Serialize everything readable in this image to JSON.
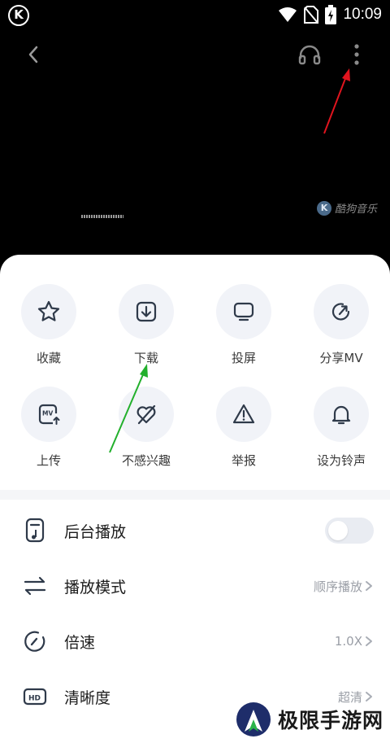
{
  "status_bar": {
    "app_logo": "K",
    "time": "10:09",
    "icons": [
      "wifi-icon",
      "no-sim-icon",
      "battery-icon"
    ]
  },
  "video_header": {
    "icons": [
      "back-icon",
      "headphones-icon",
      "more-vertical-icon"
    ],
    "watermark_text": "酷狗音乐",
    "watermark_logo": "K"
  },
  "sheet": {
    "grid_row1": [
      {
        "label": "收藏",
        "icon": "star-icon"
      },
      {
        "label": "下载",
        "icon": "download-icon"
      },
      {
        "label": "投屏",
        "icon": "cast-screen-icon"
      },
      {
        "label": "分享MV",
        "icon": "share-icon"
      }
    ],
    "grid_row2": [
      {
        "label": "上传",
        "icon": "upload-mv-icon"
      },
      {
        "label": "不感兴趣",
        "icon": "not-interested-icon"
      },
      {
        "label": "举报",
        "icon": "report-icon"
      },
      {
        "label": "设为铃声",
        "icon": "bell-icon"
      }
    ],
    "settings": [
      {
        "label": "后台播放",
        "icon": "background-play-icon",
        "control": "toggle",
        "toggle_on": false
      },
      {
        "label": "播放模式",
        "icon": "play-mode-icon",
        "value": "顺序播放"
      },
      {
        "label": "倍速",
        "icon": "speed-icon",
        "value": "1.0X"
      },
      {
        "label": "清晰度",
        "icon": "hd-icon",
        "value": "超清"
      }
    ]
  },
  "site_watermark": "极限手游网",
  "colors": {
    "sheet_bg": "#ffffff",
    "icon_circle_bg": "#f1f3f8",
    "icon_stroke": "#2f3a4a",
    "annotation_red": "#e0141e",
    "annotation_green": "#22b02c"
  }
}
